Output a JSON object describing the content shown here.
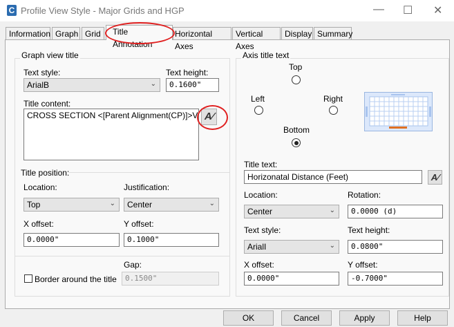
{
  "window": {
    "title": "Profile View Style - Major Grids and HGP",
    "app_icon": "C"
  },
  "tabs": [
    {
      "label": "Information"
    },
    {
      "label": "Graph"
    },
    {
      "label": "Grid"
    },
    {
      "label": "Title Annotation",
      "active": true
    },
    {
      "label": "Horizontal Axes"
    },
    {
      "label": "Vertical Axes"
    },
    {
      "label": "Display"
    },
    {
      "label": "Summary"
    }
  ],
  "graph_view_title": {
    "group_label": "Graph view title",
    "text_style_label": "Text style:",
    "text_style": "ArialB",
    "text_height_label": "Text height:",
    "text_height": "0.1600\"",
    "title_content_label": "Title content:",
    "title_content": "CROSS SECTION <[Parent Alignment(CP)]>VERTICAL",
    "title_position_label": "Title position:",
    "location_label": "Location:",
    "location": "Top",
    "justification_label": "Justification:",
    "justification": "Center",
    "x_offset_label": "X offset:",
    "x_offset": "0.0000\"",
    "y_offset_label": "Y offset:",
    "y_offset": "0.1000\"",
    "gap_label": "Gap:",
    "gap": "0.1500\"",
    "border_label": "Border around the title",
    "border_checked": false
  },
  "axis_title_text": {
    "group_label": "Axis title text",
    "top_label": "Top",
    "left_label": "Left",
    "right_label": "Right",
    "bottom_label": "Bottom",
    "selected": "Bottom",
    "title_text_label": "Title text:",
    "title_text": "Horizonatal Distance (Feet)",
    "location_label": "Location:",
    "location": "Center",
    "rotation_label": "Rotation:",
    "rotation": "0.0000 (d)",
    "text_style_label": "Text style:",
    "text_style": "ArialI",
    "text_height_label": "Text height:",
    "text_height": "0.0800\"",
    "x_offset_label": "X offset:",
    "x_offset": "0.0000\"",
    "y_offset_label": "Y offset:",
    "y_offset": "-0.7000\""
  },
  "buttons": {
    "ok": "OK",
    "cancel": "Cancel",
    "apply": "Apply",
    "help": "Help"
  },
  "colors": {
    "highlight_ellipse": "#e02020",
    "preview_bottom_text": "#e07020"
  }
}
